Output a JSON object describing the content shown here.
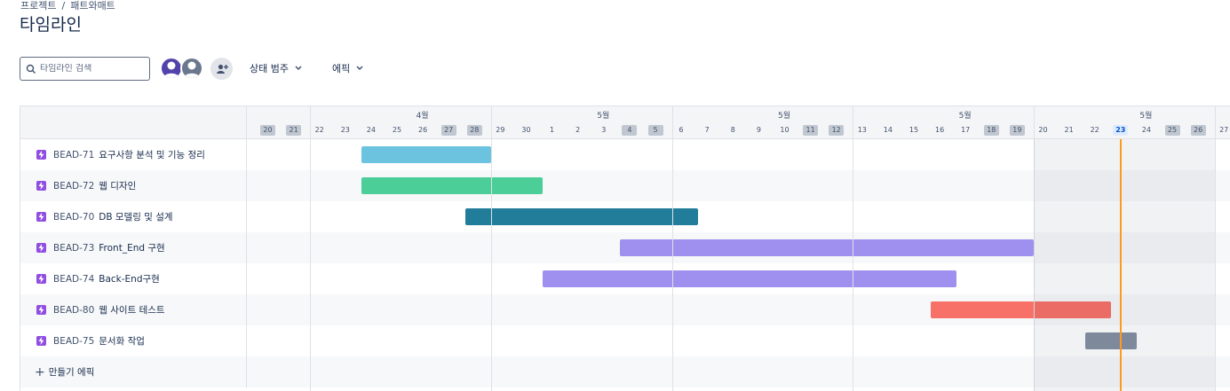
{
  "breadcrumb": {
    "project": "프로젝트",
    "separator": "/",
    "current": "패트와매트"
  },
  "page": {
    "title": "타임라인"
  },
  "toolbar": {
    "search_placeholder": "타임라인 검색",
    "status_filter": "상태 범주",
    "epic_filter": "에픽"
  },
  "icons": {
    "search": "search-icon",
    "add_user": "add-user-icon",
    "chevron": "chevron-down-icon",
    "epic": "lightning-icon",
    "plus": "plus-icon"
  },
  "colors": {
    "epic_icon": "#904ee2",
    "today": "#ff991f",
    "avatar1": "#5243aa",
    "avatar2": "#6b778c"
  },
  "timeline": {
    "months": [
      {
        "label": "4월",
        "day_index": 6
      },
      {
        "label": "5월",
        "day_index": 13
      },
      {
        "label": "5월",
        "day_index": 20
      },
      {
        "label": "5월",
        "day_index": 27
      },
      {
        "label": "5월",
        "day_index": 34
      }
    ],
    "days": [
      {
        "d": "20",
        "w": true
      },
      {
        "d": "21",
        "w": true
      },
      {
        "d": "22"
      },
      {
        "d": "23"
      },
      {
        "d": "24"
      },
      {
        "d": "25"
      },
      {
        "d": "26"
      },
      {
        "d": "27",
        "w": true
      },
      {
        "d": "28",
        "w": true
      },
      {
        "d": "29"
      },
      {
        "d": "30"
      },
      {
        "d": "1"
      },
      {
        "d": "2"
      },
      {
        "d": "3"
      },
      {
        "d": "4",
        "w": true
      },
      {
        "d": "5",
        "w": true
      },
      {
        "d": "6"
      },
      {
        "d": "7"
      },
      {
        "d": "8"
      },
      {
        "d": "9"
      },
      {
        "d": "10"
      },
      {
        "d": "11",
        "w": true
      },
      {
        "d": "12",
        "w": true
      },
      {
        "d": "13"
      },
      {
        "d": "14"
      },
      {
        "d": "15"
      },
      {
        "d": "16"
      },
      {
        "d": "17"
      },
      {
        "d": "18",
        "w": true
      },
      {
        "d": "19",
        "w": true
      },
      {
        "d": "20"
      },
      {
        "d": "21"
      },
      {
        "d": "22"
      },
      {
        "d": "23",
        "today": true
      },
      {
        "d": "24"
      },
      {
        "d": "25",
        "w": true
      },
      {
        "d": "26",
        "w": true
      },
      {
        "d": "27"
      }
    ],
    "today_index": 33,
    "shaded_from_index": 30,
    "shaded_to_index": 37,
    "issues": [
      {
        "key": "BEAD-71",
        "title": "요구사항 분석 및 기능 정리",
        "color": "#6cc3e0",
        "start": 4,
        "end": 9
      },
      {
        "key": "BEAD-72",
        "title": "웹 디자인",
        "color": "#4bce97",
        "start": 4,
        "end": 11
      },
      {
        "key": "BEAD-70",
        "title": "DB 모델링 및 설계",
        "color": "#227d9b",
        "start": 8,
        "end": 17
      },
      {
        "key": "BEAD-73",
        "title": "Front_End 구현",
        "color": "#9f8fef",
        "start": 14,
        "end": 30
      },
      {
        "key": "BEAD-74",
        "title": "Back-End구현",
        "color": "#9f8fef",
        "start": 11,
        "end": 27
      },
      {
        "key": "BEAD-80",
        "title": "웹 사이트 테스트",
        "color": "#f87168",
        "start": 26,
        "end": 33
      },
      {
        "key": "BEAD-75",
        "title": "문서화 작업",
        "color": "#8590a2",
        "start": 32,
        "end": 34
      }
    ],
    "create_label": "만들기 에픽"
  }
}
